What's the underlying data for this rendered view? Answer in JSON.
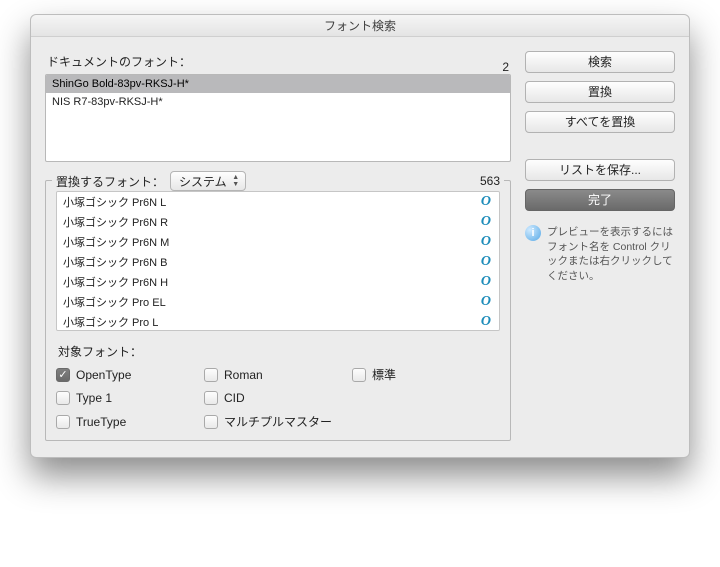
{
  "window": {
    "title": "フォント検索"
  },
  "doc": {
    "label": "ドキュメントのフォント：",
    "count": "2",
    "rows": [
      {
        "text": "ShinGo Bold-83pv-RKSJ-H*",
        "selected": true
      },
      {
        "text": "NIS R7-83pv-RKSJ-H*",
        "selected": false
      }
    ]
  },
  "replace": {
    "legend": "置換するフォント：",
    "source_select": "システム",
    "count": "563",
    "rows": [
      "小塚ゴシック Pr6N L",
      "小塚ゴシック Pr6N R",
      "小塚ゴシック Pr6N M",
      "小塚ゴシック Pr6N B",
      "小塚ゴシック Pr6N H",
      "小塚ゴシック Pro EL",
      "小塚ゴシック Pro L"
    ],
    "badge": "O"
  },
  "target": {
    "label": "対象フォント：",
    "checks": [
      {
        "label": "OpenType",
        "on": true
      },
      {
        "label": "Roman",
        "on": false
      },
      {
        "label": "標準",
        "on": false
      },
      {
        "label": "Type 1",
        "on": false
      },
      {
        "label": "CID",
        "on": false
      },
      {
        "label": "",
        "on": false,
        "hidden": true
      },
      {
        "label": "TrueType",
        "on": false
      },
      {
        "label": "マルチプルマスター",
        "on": false
      }
    ]
  },
  "buttons": {
    "find": "検索",
    "replace": "置換",
    "replace_all": "すべてを置換",
    "save_list": "リストを保存...",
    "done": "完了"
  },
  "info": {
    "text": "プレビューを表示するにはフォント名を Control クリックまたは右クリックしてください。"
  }
}
